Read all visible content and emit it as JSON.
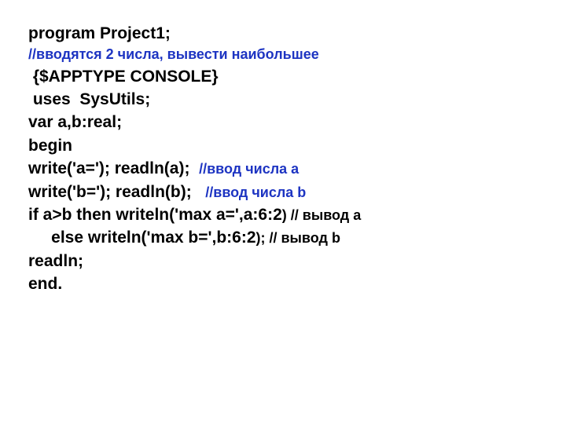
{
  "code": {
    "l1": "program Project1;",
    "l2": "//вводятся 2 числа, вывести наибольшее",
    "l3": " {$APPTYPE CONSOLE}",
    "l4": " uses  SysUtils;",
    "l5": "var a,b:real;",
    "l6": "begin",
    "l7a": "write('a='); readln(a);  ",
    "l7b": "//ввод числа a",
    "l8a": "write('b='); readln(b);   ",
    "l8b": "//ввод числа b",
    "l9a": "if a>b then writeln('max a=',a:6:2",
    "l9b": ") // вывод a",
    "l10a": "     else writeln('max b=',b:6:2",
    "l10b": "); // вывод b",
    "l11": "readln;",
    "l12": "end."
  }
}
